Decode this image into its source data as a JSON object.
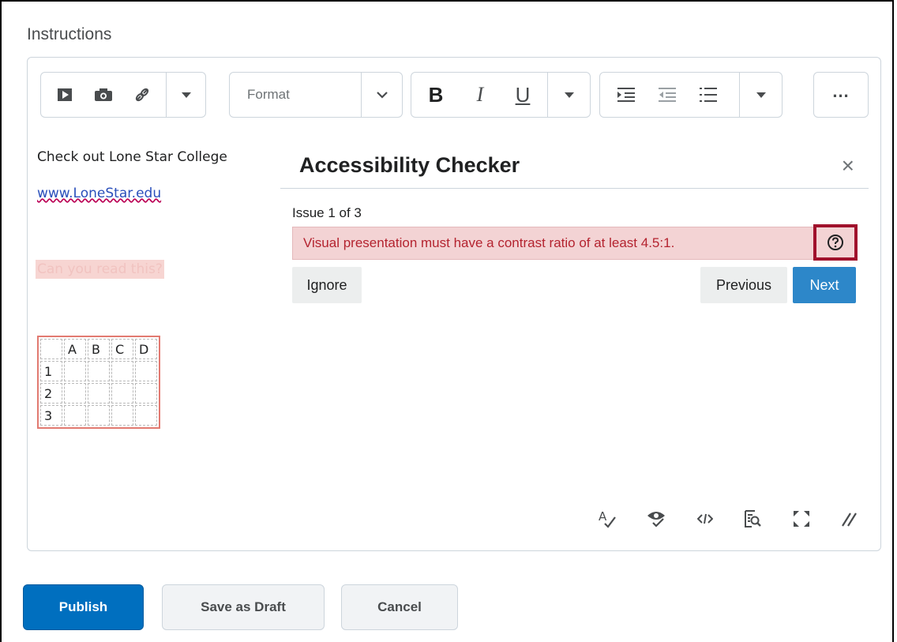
{
  "section": {
    "title": "Instructions"
  },
  "toolbar": {
    "format_label": "Format",
    "bold": "B",
    "italic": "I",
    "underline": "U",
    "more": "..."
  },
  "content": {
    "line1": "Check out Lone Star College",
    "link": "www.LoneStar.edu",
    "low_contrast": "Can you read this?",
    "table": {
      "headers": [
        "",
        "A",
        "B",
        "C",
        "D"
      ],
      "rows": [
        [
          "1",
          "",
          "",
          "",
          ""
        ],
        [
          "2",
          "",
          "",
          "",
          ""
        ],
        [
          "3",
          "",
          "",
          "",
          ""
        ]
      ]
    }
  },
  "checker": {
    "title": "Accessibility Checker",
    "close": "×",
    "issue_count": "Issue 1 of 3",
    "issue_text": "Visual presentation must have a contrast ratio of at least 4.5:1.",
    "ignore": "Ignore",
    "previous": "Previous",
    "next": "Next"
  },
  "actions": {
    "publish": "Publish",
    "save_draft": "Save as Draft",
    "cancel": "Cancel"
  },
  "colors": {
    "primary": "#006fbf",
    "next": "#2d87c9",
    "issue_bg": "#f3d3d4",
    "issue_text": "#b4232f",
    "highlight_border": "#a0112c"
  }
}
